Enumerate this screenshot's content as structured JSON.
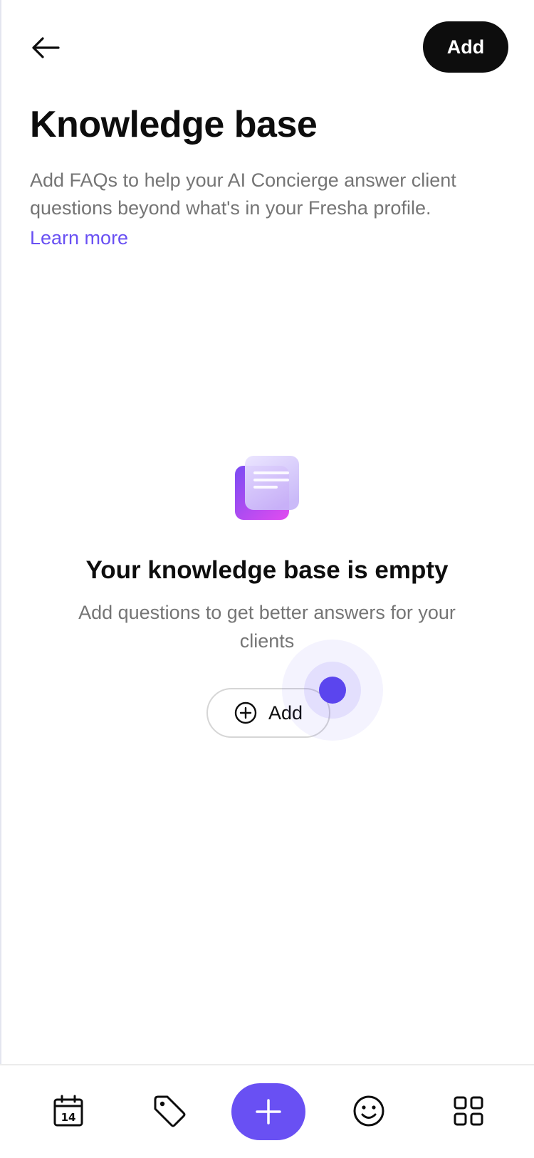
{
  "header": {
    "back_icon": "arrow-left-icon",
    "add_label": "Add"
  },
  "page": {
    "title": "Knowledge base",
    "description": "Add FAQs to help your AI Concierge answer client questions beyond what's in your Fresha profile.",
    "learn_more": "Learn more"
  },
  "empty_state": {
    "illustration": "document-stack-icon",
    "title": "Your knowledge base is empty",
    "subtitle": "Add questions to get better answers for your clients",
    "add_icon": "plus-circle-icon",
    "add_label": "Add"
  },
  "bottom_nav": {
    "items": [
      {
        "name": "calendar",
        "icon": "calendar-icon",
        "calendar_day": "14"
      },
      {
        "name": "sales",
        "icon": "tag-icon"
      },
      {
        "name": "add",
        "icon": "plus-icon"
      },
      {
        "name": "clients",
        "icon": "smiley-icon"
      },
      {
        "name": "more",
        "icon": "grid-icon"
      }
    ]
  },
  "colors": {
    "accent": "#6950f3",
    "primary_button": "#0d0d0d",
    "text_secondary": "#757575",
    "link": "#6950f3",
    "touch_indicator": "#5b45ee"
  }
}
